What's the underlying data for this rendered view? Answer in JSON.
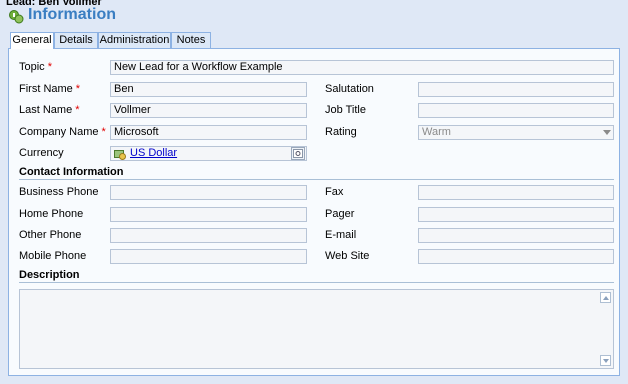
{
  "header": {
    "breadcrumb": "Lead: Ben Vollmer",
    "title": "Information",
    "title_icon": "form-info-icon"
  },
  "tabs": [
    {
      "label": "General",
      "active": true
    },
    {
      "label": "Details",
      "active": false
    },
    {
      "label": "Administration",
      "active": false
    },
    {
      "label": "Notes",
      "active": false
    }
  ],
  "general": {
    "topic": {
      "label": "Topic",
      "value": "New Lead for a Workflow Example",
      "required": "*"
    },
    "first_name": {
      "label": "First Name",
      "value": "Ben",
      "required": "*"
    },
    "last_name": {
      "label": "Last Name",
      "value": "Vollmer",
      "required": "*"
    },
    "company_name": {
      "label": "Company Name",
      "value": "Microsoft",
      "required": "*"
    },
    "currency": {
      "label": "Currency",
      "value": "US Dollar",
      "icon": "currency-icon",
      "lookup_icon": "lookup-icon"
    },
    "salutation": {
      "label": "Salutation",
      "value": ""
    },
    "job_title": {
      "label": "Job Title",
      "value": ""
    },
    "rating": {
      "label": "Rating",
      "value": "Warm"
    }
  },
  "contact_section": {
    "title": "Contact Information",
    "business_phone": {
      "label": "Business Phone",
      "value": ""
    },
    "home_phone": {
      "label": "Home Phone",
      "value": ""
    },
    "other_phone": {
      "label": "Other Phone",
      "value": ""
    },
    "mobile_phone": {
      "label": "Mobile Phone",
      "value": ""
    },
    "fax": {
      "label": "Fax",
      "value": ""
    },
    "pager": {
      "label": "Pager",
      "value": ""
    },
    "email": {
      "label": "E-mail",
      "value": ""
    },
    "web_site": {
      "label": "Web Site",
      "value": ""
    }
  },
  "description_section": {
    "title": "Description",
    "value": ""
  },
  "colors": {
    "accent": "#3a7ec2",
    "required": "#e00000",
    "link": "#0000cc",
    "background": "#dfe8f6"
  }
}
